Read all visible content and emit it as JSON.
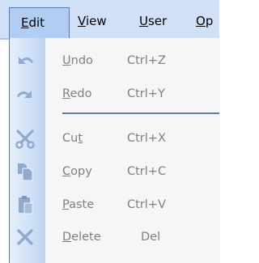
{
  "menubar": {
    "items": [
      {
        "label": "Edit",
        "u": "E",
        "rest": "dit"
      },
      {
        "label": "View",
        "u": "V",
        "rest": "iew"
      },
      {
        "label": "User",
        "u": "U",
        "rest": "ser"
      },
      {
        "label": "Op",
        "u": "O",
        "rest": "p"
      }
    ]
  },
  "menu": {
    "items": [
      {
        "label": "Undo",
        "pre": "",
        "u": "U",
        "post": "ndo",
        "shortcut": "Ctrl+Z",
        "icon": "undo-icon"
      },
      {
        "label": "Redo",
        "pre": "",
        "u": "R",
        "post": "edo",
        "shortcut": "Ctrl+Y",
        "icon": "redo-icon"
      },
      {
        "label": "Cut",
        "pre": "Cu",
        "u": "t",
        "post": "",
        "shortcut": "Ctrl+X",
        "icon": "scissors-icon"
      },
      {
        "label": "Copy",
        "pre": "",
        "u": "C",
        "post": "opy",
        "shortcut": "Ctrl+C",
        "icon": "copy-icon"
      },
      {
        "label": "Paste",
        "pre": "",
        "u": "P",
        "post": "aste",
        "shortcut": "Ctrl+V",
        "icon": "clipboard-icon"
      },
      {
        "label": "Delete",
        "pre": "",
        "u": "D",
        "post": "elete",
        "shortcut": "Del",
        "icon": "delete-icon"
      }
    ]
  },
  "colors": {
    "menubar_bg": "#cfe0f7",
    "active_bg": "#b2cdf3",
    "border": "#5a7bb1",
    "disabled_text": "#7f7f7f",
    "icon_disabled": "#8fa9cf"
  }
}
